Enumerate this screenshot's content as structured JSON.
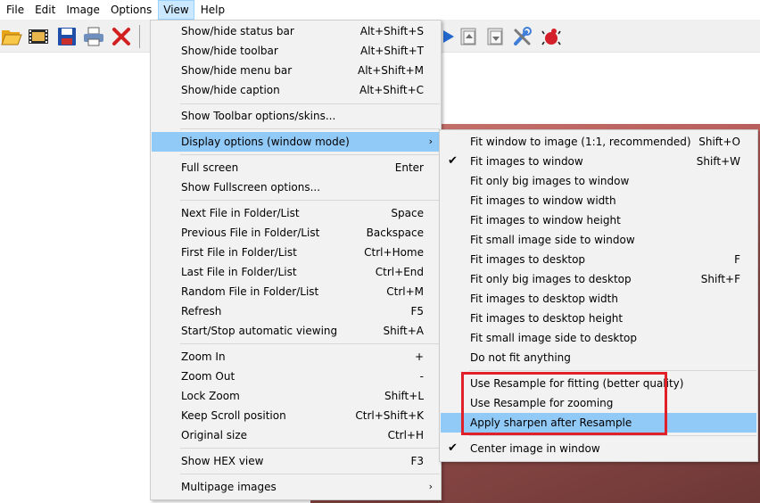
{
  "menubar": {
    "file": "File",
    "edit": "Edit",
    "image": "Image",
    "options": "Options",
    "view": "View",
    "help": "Help"
  },
  "toolbar": {
    "icons": [
      "open-folder-icon",
      "filmstrip-icon",
      "save-disk-icon",
      "print-icon",
      "delete-x-icon",
      "play-icon",
      "copy-page-up-icon",
      "copy-page-down-icon",
      "tools-icon",
      "bug-icon"
    ]
  },
  "view_menu": {
    "items": [
      {
        "label": "Show/hide status bar",
        "shortcut": "Alt+Shift+S"
      },
      {
        "label": "Show/hide toolbar",
        "shortcut": "Alt+Shift+T"
      },
      {
        "label": "Show/hide menu bar",
        "shortcut": "Alt+Shift+M"
      },
      {
        "label": "Show/hide caption",
        "shortcut": "Alt+Shift+C"
      },
      {
        "label": "Show Toolbar options/skins...",
        "shortcut": ""
      },
      {
        "label": "Display options (window mode)",
        "shortcut": ""
      },
      {
        "label": "Full screen",
        "shortcut": "Enter"
      },
      {
        "label": "Show Fullscreen options...",
        "shortcut": ""
      },
      {
        "label": "Next File in Folder/List",
        "shortcut": "Space"
      },
      {
        "label": "Previous File in Folder/List",
        "shortcut": "Backspace"
      },
      {
        "label": "First File in Folder/List",
        "shortcut": "Ctrl+Home"
      },
      {
        "label": "Last File in Folder/List",
        "shortcut": "Ctrl+End"
      },
      {
        "label": "Random File in Folder/List",
        "shortcut": "Ctrl+M"
      },
      {
        "label": "Refresh",
        "shortcut": "F5"
      },
      {
        "label": "Start/Stop automatic viewing",
        "shortcut": "Shift+A"
      },
      {
        "label": "Zoom In",
        "shortcut": "+"
      },
      {
        "label": "Zoom Out",
        "shortcut": "-"
      },
      {
        "label": "Lock Zoom",
        "shortcut": "Shift+L"
      },
      {
        "label": "Keep Scroll position",
        "shortcut": "Ctrl+Shift+K"
      },
      {
        "label": "Original size",
        "shortcut": "Ctrl+H"
      },
      {
        "label": "Show HEX view",
        "shortcut": "F3"
      },
      {
        "label": "Multipage images",
        "shortcut": ""
      }
    ]
  },
  "display_submenu": {
    "items": [
      {
        "label": "Fit window to image (1:1, recommended)",
        "shortcut": "Shift+O",
        "checked": false
      },
      {
        "label": "Fit images to window",
        "shortcut": "Shift+W",
        "checked": true
      },
      {
        "label": "Fit only big images to window",
        "shortcut": "",
        "checked": false
      },
      {
        "label": "Fit images to window width",
        "shortcut": "",
        "checked": false
      },
      {
        "label": "Fit images to window height",
        "shortcut": "",
        "checked": false
      },
      {
        "label": "Fit small image side to window",
        "shortcut": "",
        "checked": false
      },
      {
        "label": "Fit images to desktop",
        "shortcut": "F",
        "checked": false
      },
      {
        "label": "Fit only big images to desktop",
        "shortcut": "Shift+F",
        "checked": false
      },
      {
        "label": "Fit images to desktop width",
        "shortcut": "",
        "checked": false
      },
      {
        "label": "Fit images to desktop height",
        "shortcut": "",
        "checked": false
      },
      {
        "label": "Fit small image side to desktop",
        "shortcut": "",
        "checked": false
      },
      {
        "label": "Do not fit anything",
        "shortcut": "",
        "checked": false
      },
      {
        "label": "Use Resample for fitting (better quality)",
        "shortcut": "",
        "checked": false
      },
      {
        "label": "Use Resample for zooming",
        "shortcut": "",
        "checked": false
      },
      {
        "label": "Apply sharpen after Resample",
        "shortcut": "",
        "checked": false
      },
      {
        "label": "Center image in window",
        "shortcut": "",
        "checked": true
      }
    ]
  },
  "colors": {
    "highlight": "#91c9f7",
    "menu_bg": "#f2f2f2",
    "annotation": "#e0202b"
  }
}
